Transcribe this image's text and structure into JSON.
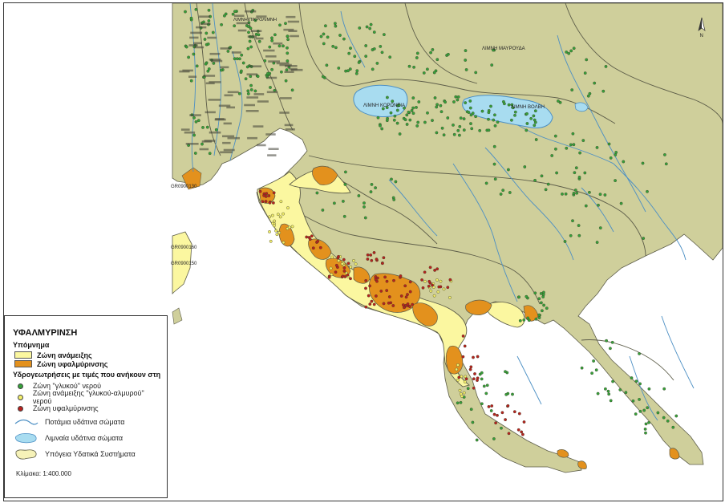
{
  "colors": {
    "land": "#cfcf9b",
    "sea": "#ffffff",
    "mixing_zone": "#fbf7a0",
    "salinization_zone": "#e3911d",
    "lake": "#a8dcf0",
    "river": "#4c8fc4",
    "fresh_point": "#35a23a",
    "mixed_point": "#f3ef6a",
    "saline_point": "#b9211d",
    "boundary": "#5d5d49"
  },
  "map": {
    "lake_labels": [
      "ΛΙΜΝΗ ΚΟΡΩΝΕΙΑ",
      "ΛΙΜΝΗ ΒΟΛΒΗ"
    ],
    "place_labels": [
      "ΛΙΜΝΗ ΜΑΥΡΟΥΔΑ",
      "ΛΙΜΝΗ ΠΙΚΡΟΛΙΜΝΗ"
    ],
    "code_labels": [
      "GR0900130",
      "GR0900160",
      "GR0900150"
    ],
    "north_letter": "N"
  },
  "legend": {
    "title": "ΥΦΑΛΜΥΡΙΝΣΗ",
    "section": "Υπόμνημα",
    "zones": [
      "Ζώνη ανάμειξης",
      "Ζώνη υφαλμύρινσης"
    ],
    "points_title": "Υδρογεωτρήσεις με τιμές που ανήκουν στη",
    "points": [
      "Ζώνη \"γλυκού\" νερού",
      "Ζώνη ανάμειξης \"γλυκού-αλμυρού\" νερού",
      "Ζώνη υφαλμύρινσης"
    ],
    "rivers": "Ποτάμια υδάτινα σώματα",
    "lakes": "Λιμναία υδάτινα σώματα",
    "aquifers": "Υπόγεια Υδατικά Συστήματα",
    "scale": "Κλίμακα: 1:400.000"
  }
}
